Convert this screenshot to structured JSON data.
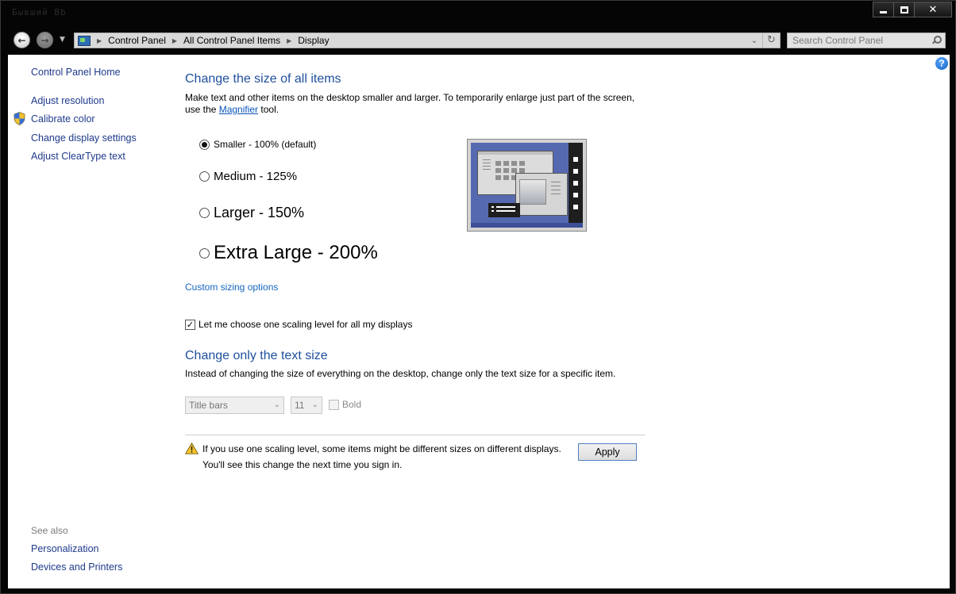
{
  "titlebar": {
    "ghost_text": "Бывший Bb"
  },
  "nav": {
    "breadcrumbs": [
      "Control Panel",
      "All Control Panel Items",
      "Display"
    ],
    "search_placeholder": "Search Control Panel"
  },
  "sidebar": {
    "home": "Control Panel Home",
    "links": [
      "Adjust resolution",
      "Calibrate color",
      "Change display settings",
      "Adjust ClearType text"
    ],
    "see_also_label": "See also",
    "see_also_links": [
      "Personalization",
      "Devices and Printers"
    ]
  },
  "size_section": {
    "heading": "Change the size of all items",
    "desc_line1": "Make text and other items on the desktop smaller and larger. To temporarily enlarge just part of the screen,",
    "desc_line2_pre": "use the ",
    "magnifier_link": "Magnifier",
    "desc_line2_post": " tool.",
    "options": [
      {
        "label": "Smaller - 100% (default)",
        "selected": true
      },
      {
        "label": "Medium - 125%",
        "selected": false
      },
      {
        "label": "Larger - 150%",
        "selected": false
      },
      {
        "label": "Extra Large - 200%",
        "selected": false
      }
    ],
    "custom_link": "Custom sizing options",
    "one_level_checkbox": {
      "label": "Let me choose one scaling level for all my displays",
      "checked": true
    }
  },
  "text_section": {
    "heading": "Change only the text size",
    "desc": "Instead of changing the size of everything on the desktop, change only the text size for a specific item.",
    "item_select": "Title bars",
    "size_select": "11",
    "bold_label": "Bold"
  },
  "footer": {
    "warning_line1": "If you use one scaling level, some items might be different sizes on different displays.",
    "warning_line2": "You'll see this change the next time you sign in.",
    "apply_label": "Apply"
  },
  "colors": {
    "heading_blue": "#1e4f9c",
    "link_blue": "#1e3a8c",
    "preview_desktop": "#5569b0"
  }
}
